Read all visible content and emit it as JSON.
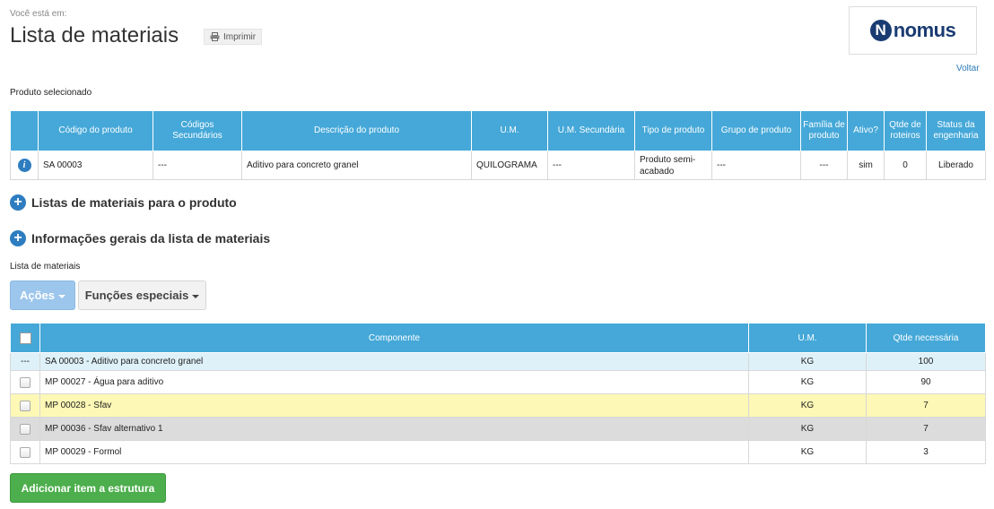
{
  "header": {
    "breadcrumb_label": "Você está em:",
    "title": "Lista de materiais",
    "print_label": "Imprimir",
    "back_label": "Voltar",
    "logo_letter": "N",
    "logo_text": "nomus"
  },
  "selected_product": {
    "label": "Produto selecionado",
    "columns": [
      "",
      "Código do produto",
      "Códigos Secundários",
      "Descrição do produto",
      "U.M.",
      "U.M. Secundária",
      "Tipo de produto",
      "Grupo de produto",
      "Família de produto",
      "Ativo?",
      "Qtde de roteiros",
      "Status da engenharia"
    ],
    "row": [
      "i",
      "SA 00003",
      "---",
      "Aditivo para concreto granel",
      "QUILOGRAMA",
      "---",
      "Produto semi-acabado",
      "---",
      "---",
      "sim",
      "0",
      "Liberado"
    ]
  },
  "sections": {
    "lists_for_product": "Listas de materiais para o produto",
    "general_info": "Informações gerais da lista de materiais",
    "bom_label": "Lista de materiais"
  },
  "toolbar": {
    "acoes_label": "Ações",
    "funcoes_label": "Funções especiais"
  },
  "bom": {
    "columns": [
      "",
      "Componente",
      "U.M.",
      "Qtde necessária"
    ],
    "rows": [
      {
        "marker": "---",
        "componente": "SA 00003 - Aditivo para concreto granel",
        "um": "KG",
        "qtde": "100",
        "bg": "#def1f9"
      },
      {
        "marker": "",
        "componente": "MP 00027 - Água para aditivo",
        "um": "KG",
        "qtde": "90",
        "bg": "#ffffff"
      },
      {
        "marker": "",
        "componente": "MP 00028 - Sfav",
        "um": "KG",
        "qtde": "7",
        "bg": "#fdf8b5"
      },
      {
        "marker": "",
        "componente": "MP 00036 - Sfav alternativo 1",
        "um": "KG",
        "qtde": "7",
        "bg": "#dcdcdc"
      },
      {
        "marker": "",
        "componente": "MP 00029 - Formol",
        "um": "KG",
        "qtde": "3",
        "bg": "#ffffff"
      }
    ]
  },
  "footer": {
    "add_item_label": "Adicionar item a estrutura"
  }
}
